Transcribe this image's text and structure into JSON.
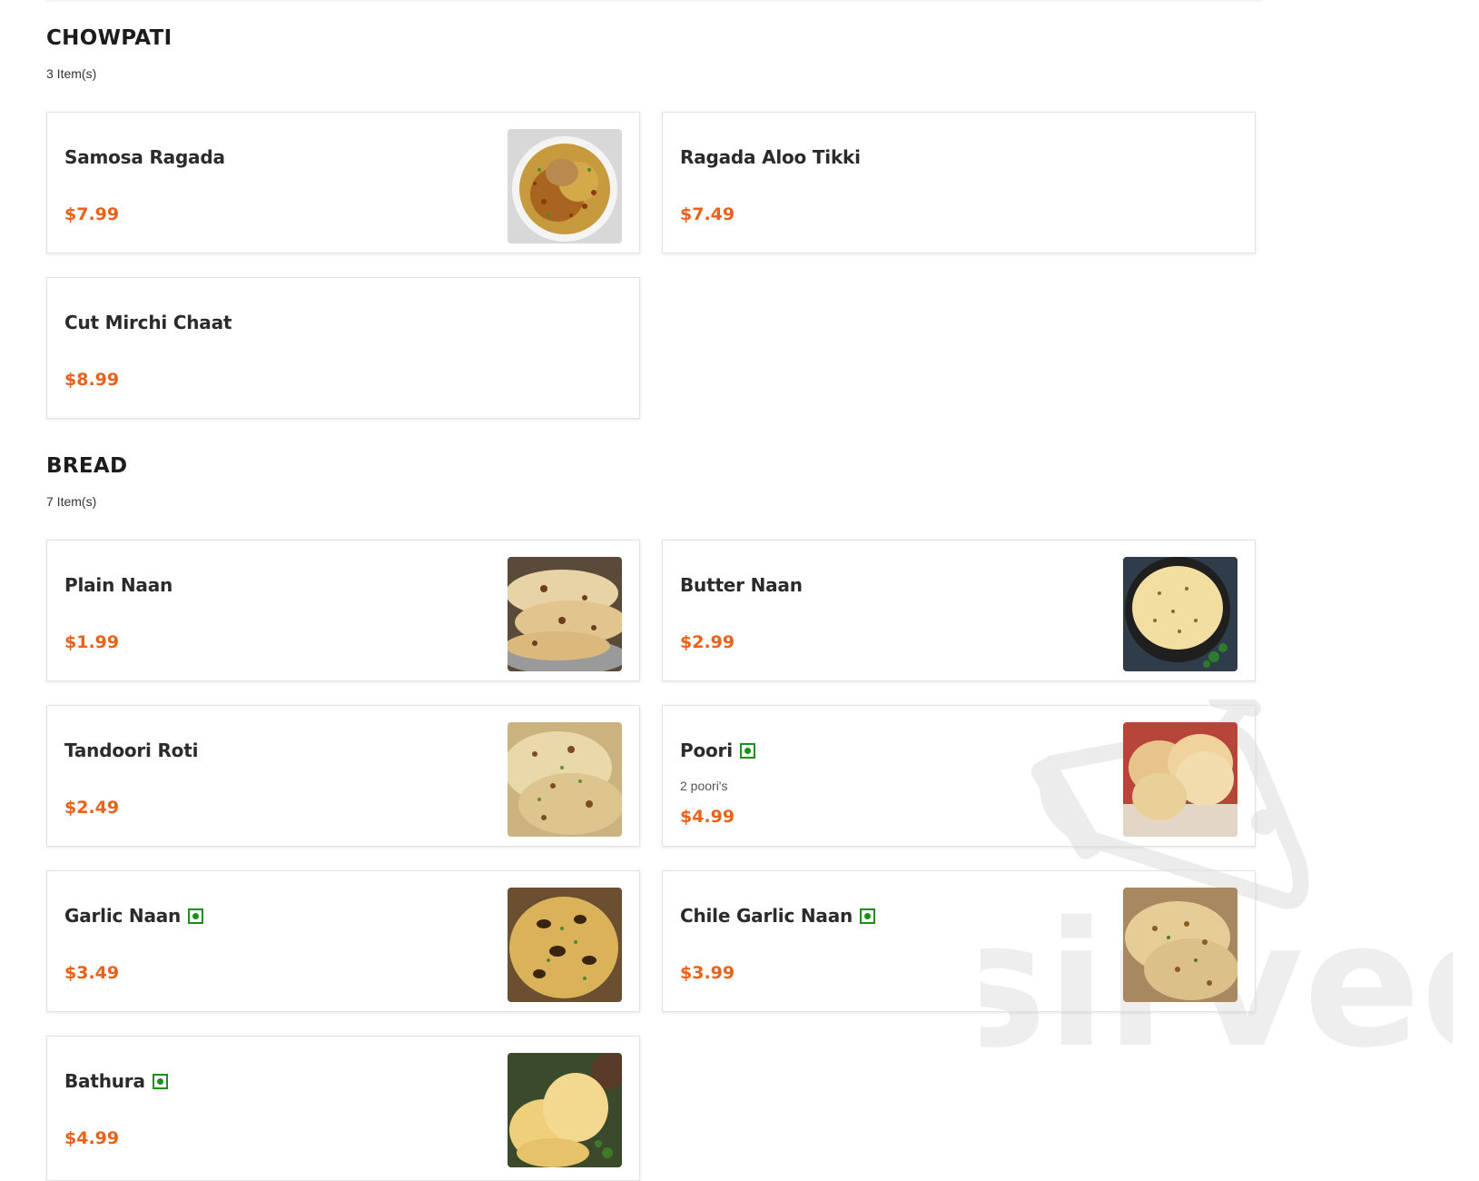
{
  "sections": [
    {
      "title": "CHOWPATI",
      "count": "3 Item(s)",
      "items": [
        {
          "name": "Samosa Ragada",
          "price": "$7.99",
          "image": "samosa-ragada-photo"
        },
        {
          "name": "Ragada Aloo Tikki",
          "price": "$7.49"
        },
        {
          "name": "Cut Mirchi Chaat",
          "price": "$8.99"
        }
      ]
    },
    {
      "title": "BREAD",
      "count": "7 Item(s)",
      "items": [
        {
          "name": "Plain Naan",
          "price": "$1.99",
          "image": "plain-naan-photo"
        },
        {
          "name": "Butter Naan",
          "price": "$2.99",
          "image": "butter-naan-photo"
        },
        {
          "name": "Tandoori Roti",
          "price": "$2.49",
          "image": "tandoori-roti-photo"
        },
        {
          "name": "Poori",
          "price": "$4.99",
          "description": "2 poori's",
          "veg": true,
          "image": "poori-photo"
        },
        {
          "name": "Garlic Naan",
          "price": "$3.49",
          "veg": true,
          "image": "garlic-naan-photo"
        },
        {
          "name": "Chile Garlic Naan",
          "price": "$3.99",
          "veg": true,
          "image": "chile-garlic-naan-photo"
        },
        {
          "name": "Bathura",
          "price": "$4.99",
          "veg": true,
          "image": "bathura-photo"
        }
      ]
    }
  ],
  "colors": {
    "price": "#e8621a",
    "veg_badge": "#1a8f1a",
    "card_border": "#e3e3e3"
  },
  "watermark": {
    "text": "sirved"
  }
}
